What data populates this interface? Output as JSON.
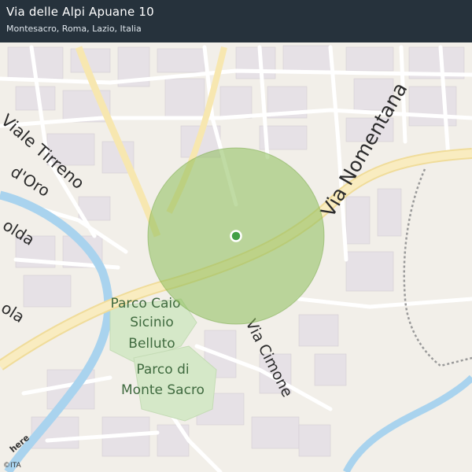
{
  "header": {
    "title": "Via delle Alpi Apuane 10",
    "subtitle": "Montesacro, Roma, Lazio, Italia"
  },
  "map": {
    "streets": {
      "viale_tirreno": "Viale  Tirreno",
      "via_nomentana": "Via  Nomentana",
      "via_cimone": "Via  Cimone",
      "d_oro": "d'Oro",
      "olda": "olda",
      "ola": "ola"
    },
    "parks": {
      "parco_caio_line1": "Parco Caio",
      "parco_caio_line2": "Sicinio",
      "parco_caio_line3": "Belluto",
      "parco_monte_line1": "Parco di",
      "parco_monte_line2": "Monte Sacro"
    },
    "colors": {
      "header_bg": "#17232e",
      "accuracy_circle": "#8dbd5a",
      "location_dot": "#43a047",
      "river": "#a9d3ee",
      "major_road": "#f7e7b0",
      "park": "#d5e8c8"
    }
  },
  "attribution": {
    "copyright": "©ITA",
    "logo": "here"
  }
}
